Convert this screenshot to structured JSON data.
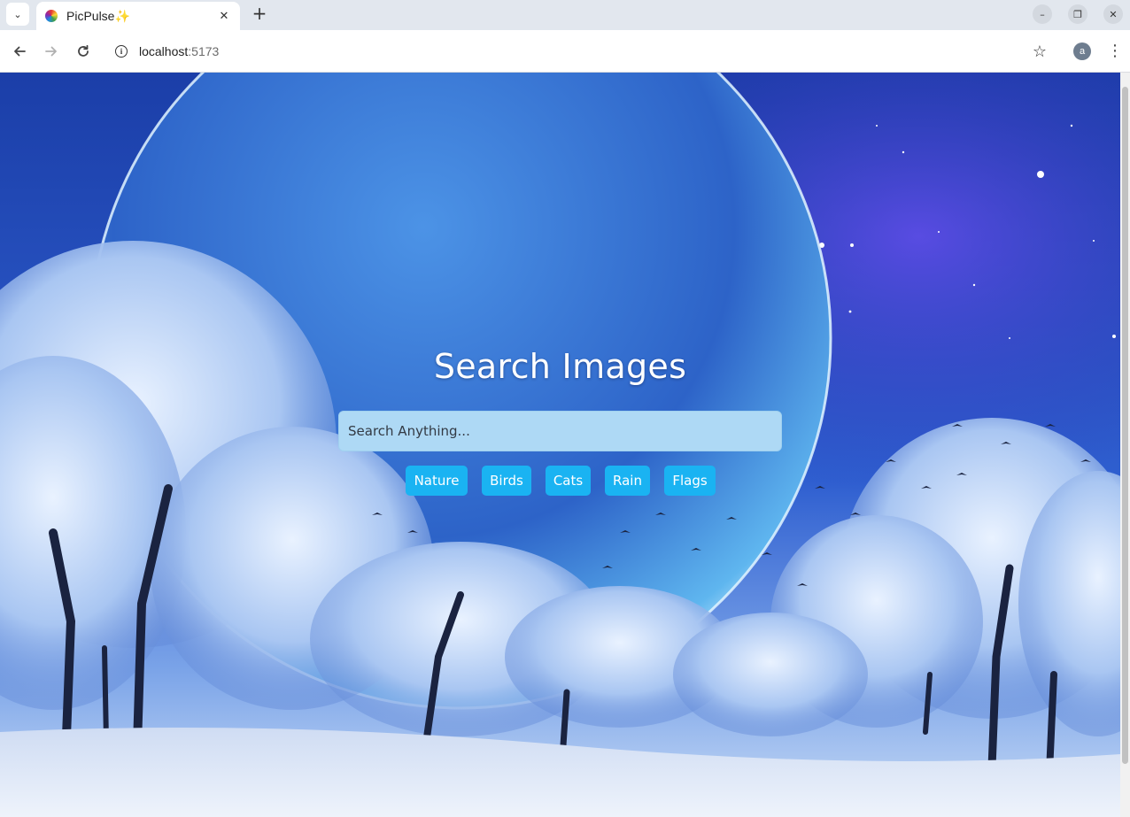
{
  "browser": {
    "tab": {
      "title": "PicPulse✨",
      "favicon": "picpulse-flower-icon"
    },
    "url": {
      "host": "localhost",
      "port": ":5173"
    },
    "profile_initial": "a",
    "icons": {
      "tab_search": "chevron-down-icon",
      "close_tab": "close-icon",
      "new_tab": "plus-icon",
      "back": "arrow-left-icon",
      "forward": "arrow-right-icon",
      "reload": "reload-icon",
      "site_info": "info-icon",
      "bookmark": "star-icon",
      "menu": "kebab-menu-icon",
      "minimize": "minimize-icon",
      "maximize": "restore-icon",
      "close_window": "close-icon"
    }
  },
  "page": {
    "title": "Search Images",
    "search": {
      "placeholder": "Search Anything...",
      "value": ""
    },
    "tags": [
      {
        "label": "Nature"
      },
      {
        "label": "Birds"
      },
      {
        "label": "Cats"
      },
      {
        "label": "Rain"
      },
      {
        "label": "Flags"
      }
    ]
  },
  "colors": {
    "tag_background": "#1ab3f2",
    "search_background": "#aed9f5",
    "title_text": "#ffffff"
  }
}
